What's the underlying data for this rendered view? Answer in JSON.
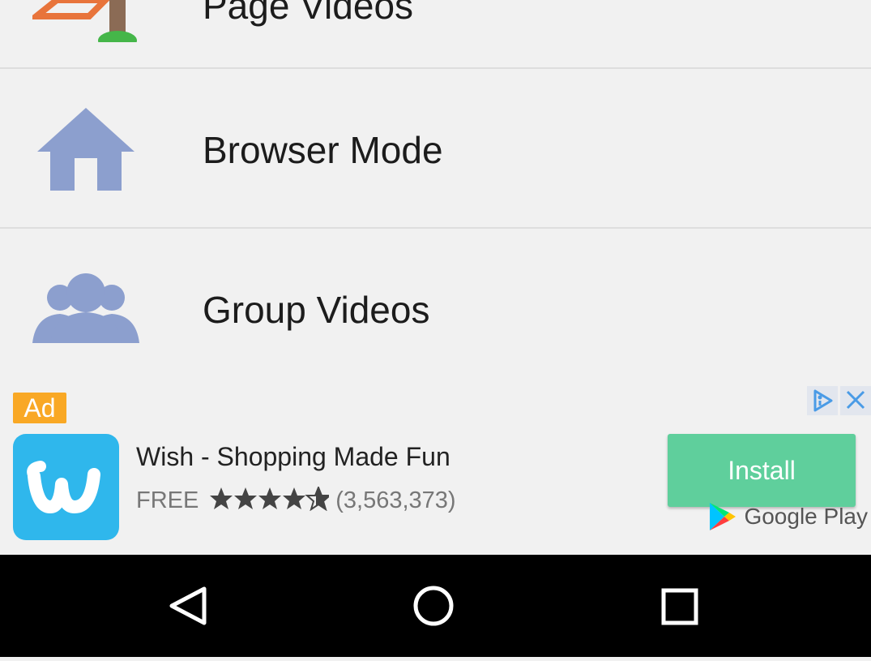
{
  "menu": {
    "items": [
      {
        "label": "Page Videos",
        "icon": "page-icon"
      },
      {
        "label": "Browser Mode",
        "icon": "home-icon"
      },
      {
        "label": "Group Videos",
        "icon": "group-icon"
      }
    ]
  },
  "ad": {
    "badge": "Ad",
    "app_name": "Wish - Shopping Made Fun",
    "price": "FREE",
    "rating": 4.5,
    "reviews": "(3,563,373)",
    "install_label": "Install",
    "store_label": "Google Play",
    "colors": {
      "install": "#5fcf9c",
      "badge": "#f9a825",
      "app_icon": "#2fb7ec"
    }
  },
  "navbar": {
    "buttons": [
      "back-icon",
      "home-circle-icon",
      "recents-icon"
    ]
  },
  "colors": {
    "icon": "#8c9fce",
    "background": "#f1f1f1"
  }
}
